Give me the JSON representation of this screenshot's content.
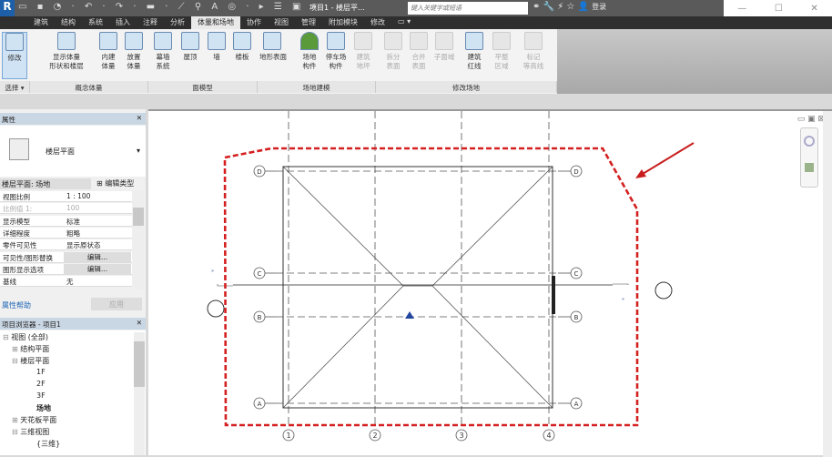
{
  "app": {
    "logo": "R",
    "title": "项目1 - 楼层平...",
    "search_placeholder": "键入关键字或短语",
    "login": "登录",
    "qat_icons": [
      "open-icon",
      "save-icon",
      "sync-icon",
      "undo-icon",
      "redo-icon",
      "measure-icon",
      "text-icon",
      "close-view-icon"
    ],
    "qat_text": "▭ ▪ ◔ · ↶ · ↷ · ▬ · ⟋ ⚲ A ◎ · ▸ ☰ ▣ »",
    "tools_text": "⚭ 🔧 ⚡ ☆ 👤",
    "win": [
      "—",
      "☐",
      "✕"
    ]
  },
  "tabs": [
    {
      "label": "建筑"
    },
    {
      "label": "结构"
    },
    {
      "label": "系统"
    },
    {
      "label": "插入"
    },
    {
      "label": "注释"
    },
    {
      "label": "分析"
    },
    {
      "label": "体量和场地",
      "active": true
    },
    {
      "label": "协作"
    },
    {
      "label": "视图"
    },
    {
      "label": "管理"
    },
    {
      "label": "附加模块"
    },
    {
      "label": "修改"
    },
    {
      "label": "▭ ▾"
    }
  ],
  "ribbon": {
    "buttons": [
      {
        "label": "修改"
      },
      {
        "label": "显示体量\n形状和楼层"
      },
      {
        "label": "内建\n体量"
      },
      {
        "label": "放置\n体量"
      },
      {
        "label": "幕墙\n系统"
      },
      {
        "label": "屋顶"
      },
      {
        "label": "墙"
      },
      {
        "label": "楼板"
      },
      {
        "label": "地形表面"
      },
      {
        "label": "场地\n构件"
      },
      {
        "label": "停车场\n构件"
      },
      {
        "label": "建筑\n地坪",
        "disabled": true
      },
      {
        "label": "拆分\n表面",
        "disabled": true
      },
      {
        "label": "合并\n表面",
        "disabled": true
      },
      {
        "label": "子面域",
        "disabled": true
      },
      {
        "label": "建筑\n红线"
      },
      {
        "label": "平整\n区域",
        "disabled": true
      },
      {
        "label": "标记\n等高线",
        "disabled": true
      }
    ],
    "panels": [
      {
        "label": "选择 ▾"
      },
      {
        "label": "概念体量"
      },
      {
        "label": "面模型"
      },
      {
        "label": "场地建模"
      },
      {
        "label": "修改场地"
      }
    ]
  },
  "properties": {
    "title": "属性",
    "type_name": "楼层平面",
    "selector": "楼层平面: 场地",
    "edit_type": "编辑类型",
    "rows": [
      {
        "key": "视图比例",
        "value": "1 : 100"
      },
      {
        "key": "比例值 1:",
        "value": "100",
        "dim": true
      },
      {
        "key": "显示模型",
        "value": "标准"
      },
      {
        "key": "详细程度",
        "value": "粗略"
      },
      {
        "key": "零件可见性",
        "value": "显示原状态"
      },
      {
        "key": "可见性/图形替换",
        "value": "编辑...",
        "button": true
      },
      {
        "key": "图形显示选项",
        "value": "编辑...",
        "button": true
      },
      {
        "key": "基线",
        "value": "无"
      }
    ],
    "help": "属性帮助",
    "apply": "应用"
  },
  "browser": {
    "title": "项目浏览器 - 项目1",
    "items": [
      {
        "label": "视图 (全部)",
        "level": 0,
        "exp": "⊟"
      },
      {
        "label": "结构平面",
        "level": 1,
        "exp": "⊞"
      },
      {
        "label": "楼层平面",
        "level": 1,
        "exp": "⊟"
      },
      {
        "label": "1F",
        "level": 2
      },
      {
        "label": "2F",
        "level": 2
      },
      {
        "label": "3F",
        "level": 2
      },
      {
        "label": "场地",
        "level": 2,
        "bold": true
      },
      {
        "label": "天花板平面",
        "level": 1,
        "exp": "⊞"
      },
      {
        "label": "三维视图",
        "level": 1,
        "exp": "⊟"
      },
      {
        "label": "{三维}",
        "level": 2
      }
    ]
  },
  "drawing": {
    "grid_columns": [
      "1",
      "2",
      "3",
      "4"
    ],
    "grid_rows": [
      "D",
      "C",
      "B",
      "A"
    ],
    "boundary_color": "#d42020",
    "arrow_color": "#c81e1e",
    "view_controls": "▭ ▣ ⊠"
  }
}
